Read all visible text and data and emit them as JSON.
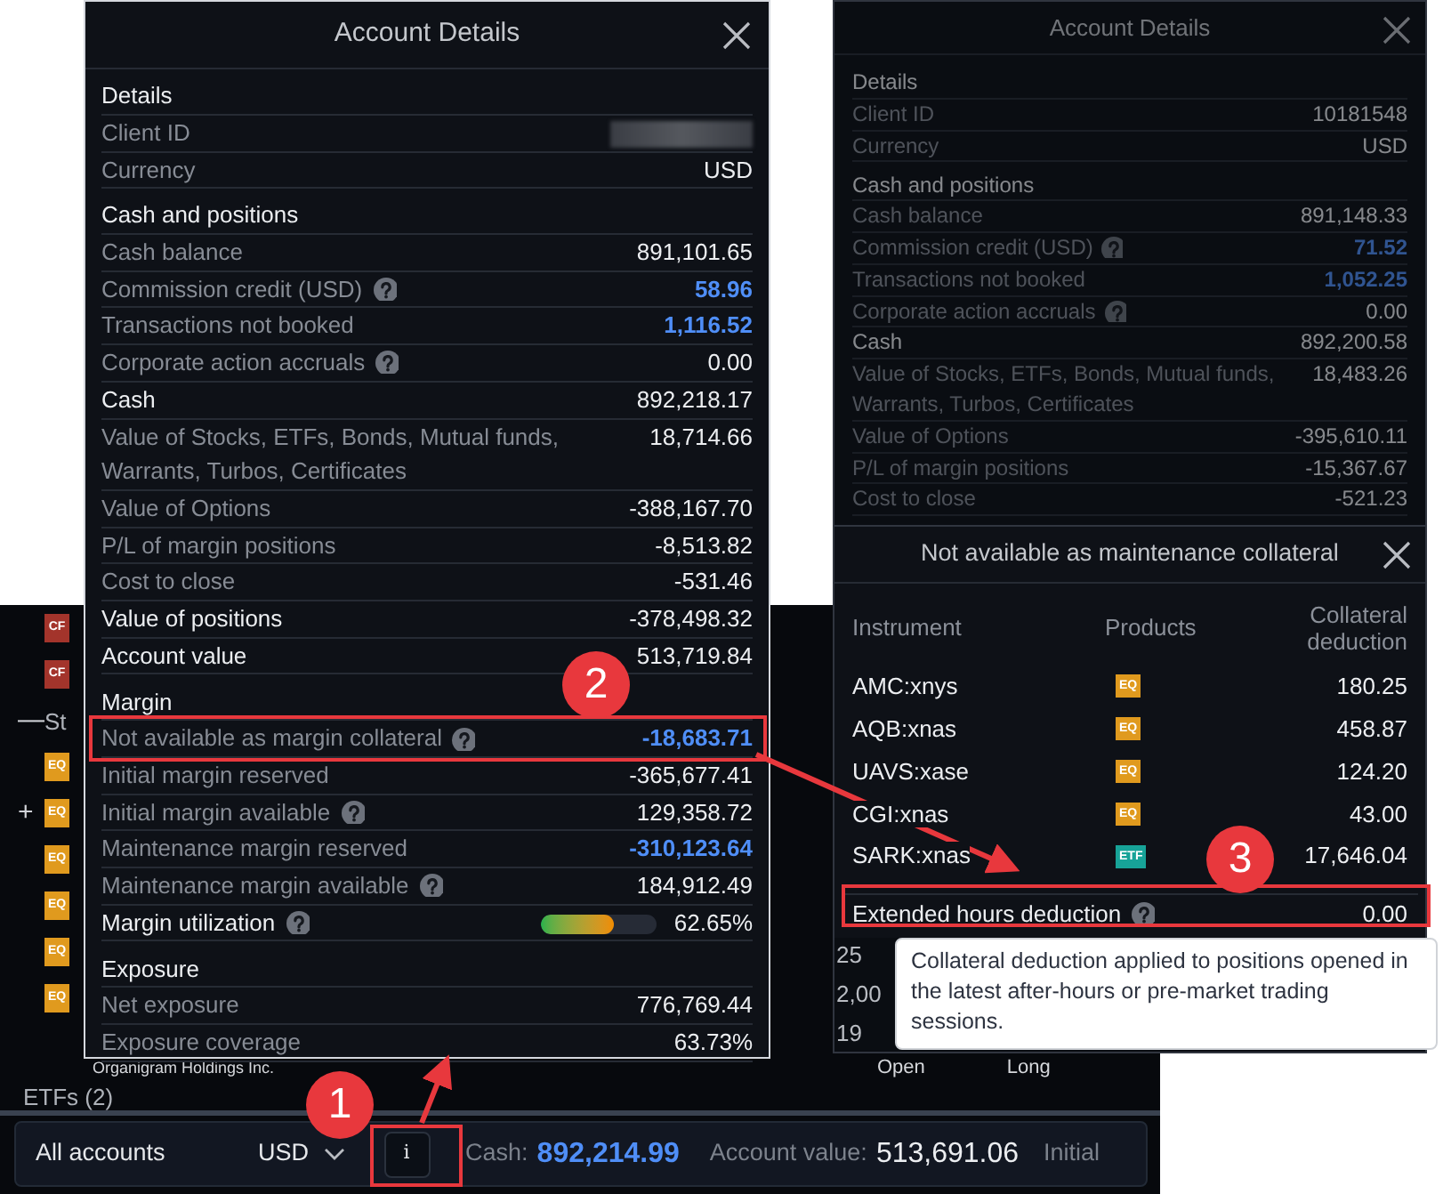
{
  "background_app": {
    "list_items": [
      {
        "kind": "badge",
        "badge": "CF",
        "color": "#a3342b"
      },
      {
        "kind": "badge",
        "badge": "CF",
        "color": "#a3342b"
      },
      {
        "kind": "group",
        "toggle": "—",
        "label": "St"
      },
      {
        "kind": "badge",
        "badge": "EQ",
        "color": "#e09a1e"
      },
      {
        "kind": "badge",
        "toggle": "+",
        "badge": "EQ",
        "color": "#e09a1e"
      },
      {
        "kind": "badge",
        "badge": "EQ",
        "color": "#e09a1e"
      },
      {
        "kind": "badge",
        "badge": "EQ",
        "color": "#e09a1e"
      },
      {
        "kind": "badge",
        "badge": "EQ",
        "color": "#e09a1e"
      },
      {
        "kind": "badge",
        "badge": "EQ",
        "color": "#e09a1e"
      },
      {
        "kind": "text",
        "label": "Organigram Holdings Inc."
      },
      {
        "kind": "group",
        "label": "ETFs (2)"
      }
    ],
    "table_fragments": [
      "25",
      "2,00",
      "19"
    ],
    "column_fragments": [
      "Open",
      "Long"
    ],
    "bottom_bar": {
      "account_selector": "All accounts",
      "currency": "USD",
      "info_button": "i",
      "cash_label": "Cash:",
      "cash_value": "892,214.99",
      "account_value_label": "Account value:",
      "account_value": "513,691.06",
      "next_label": "Initial"
    }
  },
  "main_dialog": {
    "title": "Account Details",
    "rows": [
      {
        "kind": "section",
        "label": "Details"
      },
      {
        "kind": "redacted",
        "label": "Client ID"
      },
      {
        "kind": "item",
        "label": "Currency",
        "value": "USD",
        "help": false,
        "linked": false
      },
      {
        "kind": "section",
        "label": "Cash and positions"
      },
      {
        "kind": "item",
        "label": "Cash balance",
        "value": "891,101.65",
        "help": false,
        "linked": false
      },
      {
        "kind": "item",
        "label": "Commission credit (USD)",
        "value": "58.96",
        "help": true,
        "linked": true
      },
      {
        "kind": "item",
        "label": "Transactions not booked",
        "value": "1,116.52",
        "help": false,
        "linked": true
      },
      {
        "kind": "item",
        "label": "Corporate action accruals",
        "value": "0.00",
        "help": true,
        "linked": false
      },
      {
        "kind": "total",
        "label": "Cash",
        "value": "892,218.17",
        "help": false,
        "linked": false
      },
      {
        "kind": "item",
        "label": "Value of Stocks, ETFs, Bonds, Mutual funds, Warrants, Turbos, Certificates",
        "value": "18,714.66",
        "help": false,
        "linked": false
      },
      {
        "kind": "item",
        "label": "Value of Options",
        "value": "-388,167.70",
        "help": false,
        "linked": false
      },
      {
        "kind": "item",
        "label": "P/L of margin positions",
        "value": "-8,513.82",
        "help": false,
        "linked": false
      },
      {
        "kind": "item",
        "label": "Cost to close",
        "value": "-531.46",
        "help": false,
        "linked": false
      },
      {
        "kind": "total",
        "label": "Value of positions",
        "value": "-378,498.32",
        "help": false,
        "linked": false
      },
      {
        "kind": "total",
        "label": "Account value",
        "value": "513,719.84",
        "help": false,
        "linked": false
      },
      {
        "kind": "section",
        "label": "Margin"
      },
      {
        "kind": "item",
        "label": "Not available as margin collateral",
        "value": "-18,683.71",
        "help": true,
        "linked": true
      },
      {
        "kind": "item",
        "label": "Initial margin reserved",
        "value": "-365,677.41",
        "help": false,
        "linked": false
      },
      {
        "kind": "item",
        "label": "Initial margin available",
        "value": "129,358.72",
        "help": true,
        "linked": false
      },
      {
        "kind": "item",
        "label": "Maintenance margin reserved",
        "value": "-310,123.64",
        "help": false,
        "linked": true
      },
      {
        "kind": "item",
        "label": "Maintenance margin available",
        "value": "184,912.49",
        "help": true,
        "linked": false
      },
      {
        "kind": "meter",
        "label": "Margin utilization",
        "value": "62.65%",
        "help": true,
        "level": 0.63
      },
      {
        "kind": "section",
        "label": "Exposure"
      },
      {
        "kind": "item",
        "label": "Net exposure",
        "value": "776,769.44",
        "help": false,
        "linked": false
      },
      {
        "kind": "item",
        "label": "Exposure coverage",
        "value": "63.73%",
        "help": false,
        "linked": false
      }
    ]
  },
  "right_panel": {
    "title": "Account Details",
    "rows": [
      {
        "kind": "section",
        "label": "Details"
      },
      {
        "kind": "item",
        "label": "Client ID",
        "value": "10181548",
        "help": false,
        "linked": false
      },
      {
        "kind": "item",
        "label": "Currency",
        "value": "USD",
        "help": false,
        "linked": false
      },
      {
        "kind": "section",
        "label": "Cash and positions"
      },
      {
        "kind": "item",
        "label": "Cash balance",
        "value": "891,148.33",
        "help": false,
        "linked": false
      },
      {
        "kind": "item",
        "label": "Commission credit (USD)",
        "value": "71.52",
        "help": true,
        "linked": true
      },
      {
        "kind": "item",
        "label": "Transactions not booked",
        "value": "1,052.25",
        "help": false,
        "linked": true
      },
      {
        "kind": "item",
        "label": "Corporate action accruals",
        "value": "0.00",
        "help": true,
        "linked": false
      },
      {
        "kind": "total",
        "label": "Cash",
        "value": "892,200.58",
        "help": false,
        "linked": false
      },
      {
        "kind": "item",
        "label": "Value of Stocks, ETFs, Bonds, Mutual funds, Warrants, Turbos, Certificates",
        "value": "18,483.26",
        "help": false,
        "linked": false
      },
      {
        "kind": "item",
        "label": "Value of Options",
        "value": "-395,610.11",
        "help": false,
        "linked": false
      },
      {
        "kind": "item",
        "label": "P/L of margin positions",
        "value": "-15,367.67",
        "help": false,
        "linked": false
      },
      {
        "kind": "item",
        "label": "Cost to close",
        "value": "-521.23",
        "help": false,
        "linked": false
      }
    ],
    "collateral_dialog": {
      "title": "Not available as maintenance collateral",
      "columns": [
        "Instrument",
        "Products",
        "Collateral deduction"
      ],
      "rows": [
        {
          "instrument": "AMC:xnys",
          "product": "EQ",
          "color": "#e09a1e",
          "deduction": "180.25"
        },
        {
          "instrument": "AQB:xnas",
          "product": "EQ",
          "color": "#e09a1e",
          "deduction": "458.87"
        },
        {
          "instrument": "UAVS:xase",
          "product": "EQ",
          "color": "#e09a1e",
          "deduction": "124.20"
        },
        {
          "instrument": "CGI:xnas",
          "product": "EQ",
          "color": "#e09a1e",
          "deduction": "43.00"
        },
        {
          "instrument": "SARK:xnas",
          "product": "ETF",
          "color": "#17a398",
          "deduction": "17,646.04"
        }
      ],
      "footer": {
        "label": "Extended hours deduction",
        "value": "0.00",
        "help": true
      },
      "tooltip": "Collateral deduction applied to positions opened in the latest after-hours or pre-market trading sessions."
    }
  },
  "callouts": [
    "1",
    "2",
    "3"
  ]
}
